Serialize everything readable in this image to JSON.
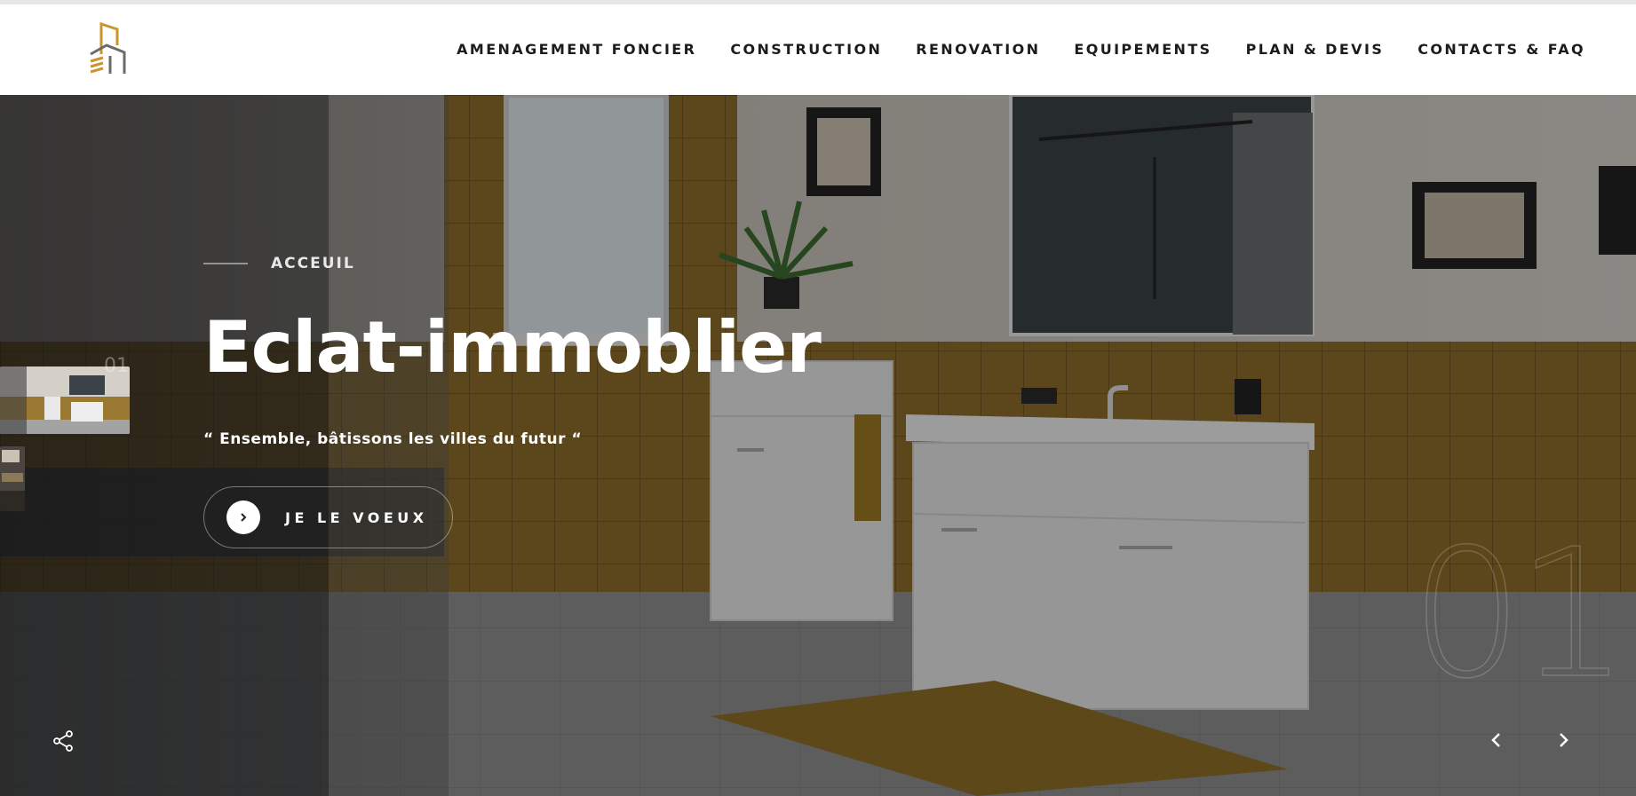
{
  "header": {
    "logo_name": "building-logo",
    "nav": [
      {
        "label": "AMENAGEMENT FONCIER"
      },
      {
        "label": "CONSTRUCTION"
      },
      {
        "label": "RENOVATION"
      },
      {
        "label": "EQUIPEMENTS"
      },
      {
        "label": "PLAN & DEVIS"
      },
      {
        "label": "CONTACTS & FAQ"
      }
    ]
  },
  "hero": {
    "eyebrow": "ACCEUIL",
    "title": "Eclat-immoblier",
    "tagline": "“ Ensemble, bâtissons les villes du futur “",
    "cta_label": "JE LE VOEUX",
    "slide_number": "01",
    "thumb_number": "01"
  },
  "colors": {
    "accent": "#c9962e",
    "logo_gray": "#6b6b6b",
    "tile_yellow": "#9c7a2c",
    "nav_text": "#1c1c1c"
  },
  "icons": {
    "share": "share-icon",
    "prev": "chevron-left-icon",
    "next": "chevron-right-icon",
    "cta": "chevron-right-icon"
  }
}
